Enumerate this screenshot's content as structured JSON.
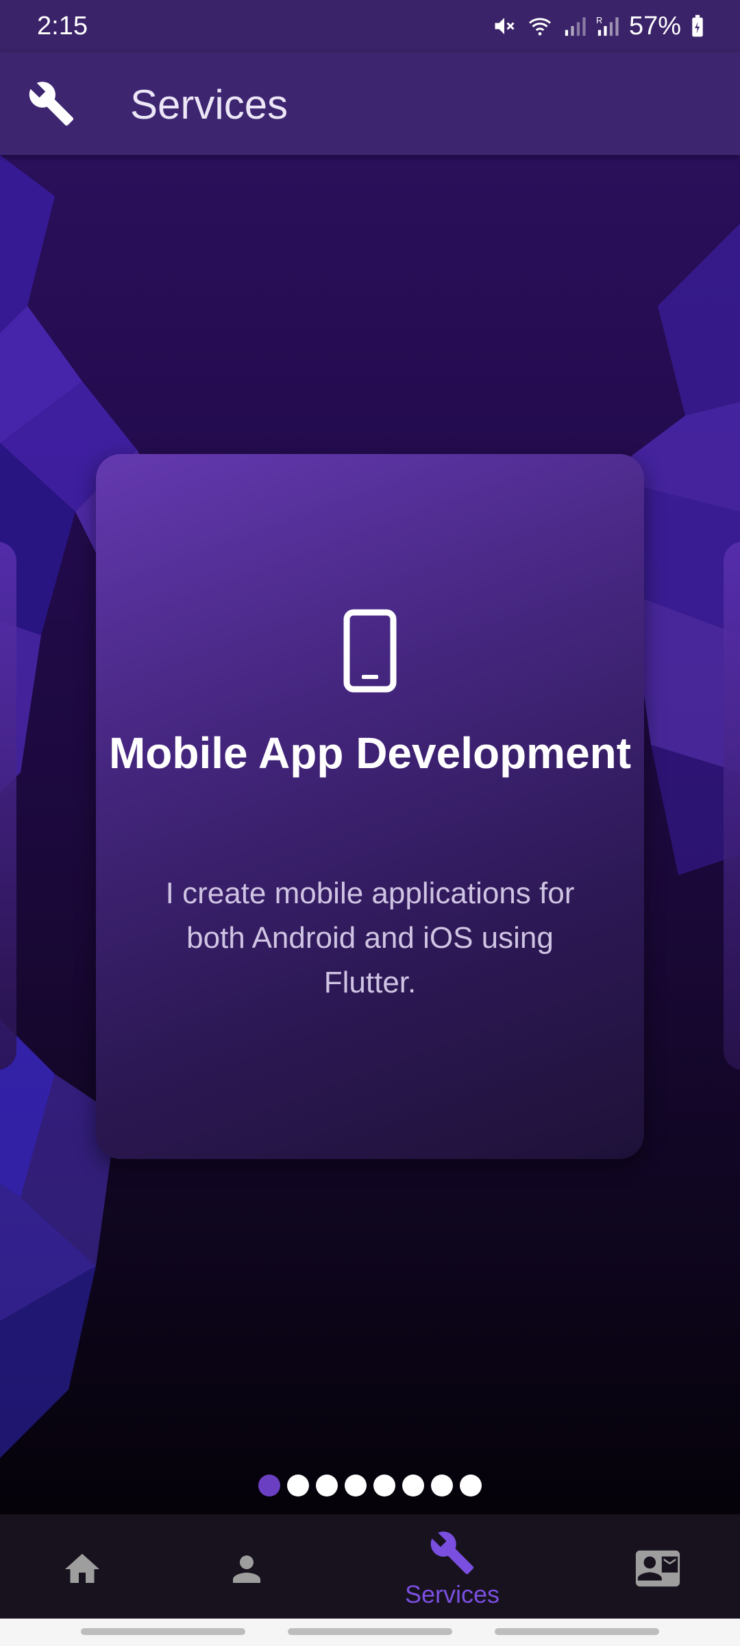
{
  "status_bar": {
    "time": "2:15",
    "battery": "57%"
  },
  "app_bar": {
    "title": "Services",
    "icon": "wrench-icon"
  },
  "carousel": {
    "card": {
      "icon": "smartphone-icon",
      "title": "Mobile App Development",
      "description": "I create mobile applications for both Android and iOS using Flutter."
    },
    "page_count": 8,
    "active_index": 0
  },
  "bottom_nav": {
    "items": [
      {
        "icon": "home-icon",
        "label": ""
      },
      {
        "icon": "person-icon",
        "label": ""
      },
      {
        "icon": "wrench-icon",
        "label": "Services",
        "active": true
      },
      {
        "icon": "contact-card-icon",
        "label": ""
      }
    ]
  },
  "colors": {
    "app_bar": "#3d2570",
    "accent": "#7a4fe0",
    "active_dot": "#6a3fc1",
    "nav_background": "#17121e"
  }
}
